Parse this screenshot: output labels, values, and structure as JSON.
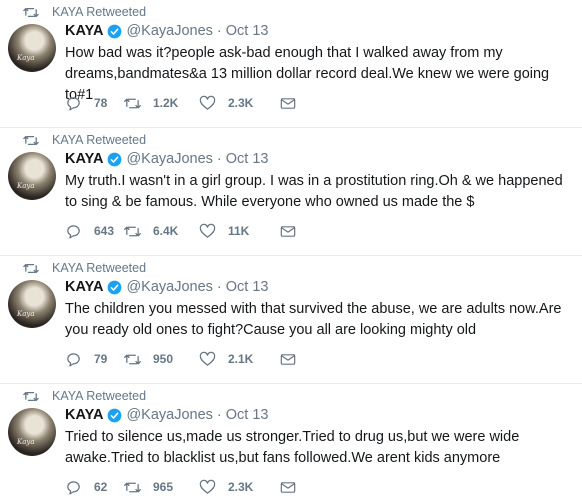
{
  "tweets": [
    {
      "retweet_label": "KAYA Retweeted",
      "name": "KAYA",
      "handle": "@KayaJones",
      "separator": "·",
      "date": "Oct 13",
      "text": "How bad was it?people ask-bad enough that I walked away from my dreams,bandmates&a 13 million dollar record deal.We knew we were going to#1",
      "replies": "78",
      "retweets": "1.2K",
      "likes": "2.3K",
      "avatar_text": "Kaya"
    },
    {
      "retweet_label": "KAYA Retweeted",
      "name": "KAYA",
      "handle": "@KayaJones",
      "separator": "·",
      "date": "Oct 13",
      "text": "My truth.I wasn't in a girl group. I was in a prostitution ring.Oh & we happened to sing & be famous. While everyone who owned us made the $",
      "replies": "643",
      "retweets": "6.4K",
      "likes": "11K",
      "avatar_text": "Kaya"
    },
    {
      "retweet_label": "KAYA Retweeted",
      "name": "KAYA",
      "handle": "@KayaJones",
      "separator": "·",
      "date": "Oct 13",
      "text": "The children you messed with that survived the abuse, we are adults now.Are you ready old ones to fight?Cause you all are looking mighty old",
      "replies": "79",
      "retweets": "950",
      "likes": "2.1K",
      "avatar_text": "Kaya"
    },
    {
      "retweet_label": "KAYA Retweeted",
      "name": "KAYA",
      "handle": "@KayaJones",
      "separator": "·",
      "date": "Oct 13",
      "text": "Tried to silence us,made us stronger.Tried to drug us,but we were wide awake.Tried to blacklist us,but fans followed.We arent kids anymore",
      "replies": "62",
      "retweets": "965",
      "likes": "2.3K",
      "avatar_text": "Kaya"
    }
  ],
  "colors": {
    "text": "#14171a",
    "muted": "#657786",
    "verified": "#1da1f2",
    "divider": "#e6ecf0"
  },
  "icons": {
    "retweeted": "retweet-icon",
    "verified": "verified-badge-icon",
    "reply": "reply-icon",
    "retweet": "retweet-icon",
    "like": "heart-icon",
    "dm": "envelope-icon"
  }
}
